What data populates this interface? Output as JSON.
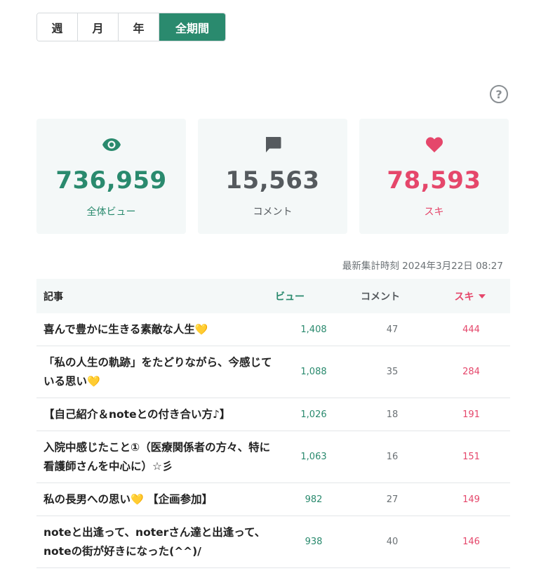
{
  "tabs": [
    {
      "label": "週",
      "active": false
    },
    {
      "label": "月",
      "active": false
    },
    {
      "label": "年",
      "active": false
    },
    {
      "label": "全期間",
      "active": true
    }
  ],
  "help_icon": "question-circle-icon",
  "stats": {
    "views": {
      "value": "736,959",
      "label": "全体ビュー",
      "icon": "eye-icon",
      "color": "#2a8a6e"
    },
    "comments": {
      "value": "15,563",
      "label": "コメント",
      "icon": "comment-icon",
      "color": "#555a5e"
    },
    "likes": {
      "value": "78,593",
      "label": "スキ",
      "icon": "heart-icon",
      "color": "#e5476b"
    }
  },
  "updated": "最新集計時刻 2024年3月22日 08:27",
  "table": {
    "headers": {
      "title": "記事",
      "views": "ビュー",
      "comments": "コメント",
      "likes": "スキ"
    },
    "rows": [
      {
        "title": "喜んで豊かに生きる素敵な人生",
        "emoji": "💛",
        "views": "1,408",
        "comments": "47",
        "likes": "444"
      },
      {
        "title": "「私の人生の軌跡」をたどりながら、今感じている思い",
        "emoji": "💛",
        "views": "1,088",
        "comments": "35",
        "likes": "284"
      },
      {
        "title": "【自己紹介＆noteとの付き合い方♪】",
        "emoji": "",
        "views": "1,026",
        "comments": "18",
        "likes": "191"
      },
      {
        "title": "入院中感じたこと①（医療関係者の方々、特に看護師さんを中心に）☆彡",
        "emoji": "",
        "views": "1,063",
        "comments": "16",
        "likes": "151"
      },
      {
        "title": "私の長男への思い",
        "emoji": "💛",
        "suffix": " 【企画参加】",
        "views": "982",
        "comments": "27",
        "likes": "149"
      },
      {
        "title": "noteと出逢って、noterさん達と出逢って、noteの街が好きになった(^^)/",
        "emoji": "",
        "views": "938",
        "comments": "40",
        "likes": "146"
      }
    ]
  },
  "colors": {
    "accent": "#2a8a6e",
    "like": "#e5476b",
    "neutral": "#555a5e"
  }
}
